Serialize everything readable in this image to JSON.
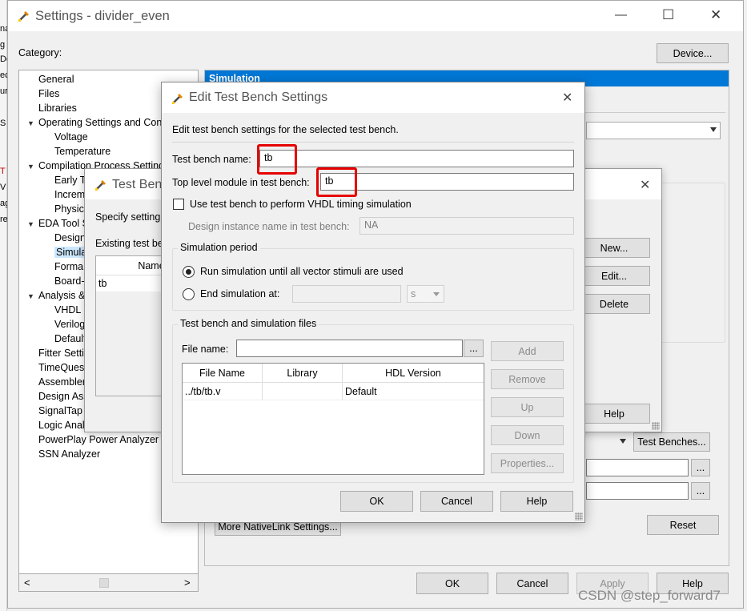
{
  "main": {
    "title": "Settings - divider_even",
    "category_label": "Category:",
    "device_button": "Device...",
    "left_edge": [
      "na",
      "g",
      "De",
      "ec",
      "ur",
      "S",
      "T",
      "V",
      "ag",
      "re"
    ],
    "tree": [
      {
        "label": "General",
        "level": 1
      },
      {
        "label": "Files",
        "level": 1
      },
      {
        "label": "Libraries",
        "level": 1
      },
      {
        "label": "Operating Settings and Con",
        "level": 0
      },
      {
        "label": "Voltage",
        "level": 2
      },
      {
        "label": "Temperature",
        "level": 2
      },
      {
        "label": "Compilation Process Setting",
        "level": 0
      },
      {
        "label": "Early T",
        "level": 2
      },
      {
        "label": "Increm",
        "level": 2
      },
      {
        "label": "Physica",
        "level": 2
      },
      {
        "label": "EDA Tool S",
        "level": 0
      },
      {
        "label": "Design",
        "level": 2
      },
      {
        "label": "Simula",
        "level": 2
      },
      {
        "label": "Forma",
        "level": 2
      },
      {
        "label": "Board-",
        "level": 2
      },
      {
        "label": "Analysis &",
        "level": 0
      },
      {
        "label": "VHDL I",
        "level": 2
      },
      {
        "label": "Verilog",
        "level": 2
      },
      {
        "label": "Default",
        "level": 2
      },
      {
        "label": "Fitter Setti",
        "level": 1
      },
      {
        "label": "TimeQues",
        "level": 1
      },
      {
        "label": "Assembler",
        "level": 1
      },
      {
        "label": "Design Ass",
        "level": 1
      },
      {
        "label": "SignalTap",
        "level": 1
      },
      {
        "label": "Logic Anal",
        "level": 1
      },
      {
        "label": "PowerPlay Power Analyzer",
        "level": 1
      },
      {
        "label": "SSN Analyzer",
        "level": 1
      }
    ],
    "panel_header": "Simulation",
    "more_nativelink_button": "More NativeLink Settings...",
    "reset_button": "Reset",
    "test_benches_button": "Test Benches...",
    "browse_label": "...",
    "ok": "OK",
    "cancel": "Cancel",
    "apply": "Apply",
    "help": "Help",
    "scroll_left": "<",
    "scroll_right": ">",
    "minimize": "—",
    "maximize": "☐",
    "close": "✕"
  },
  "test_benches_dialog": {
    "title": "Test Bench",
    "specify_text": "Specify setting",
    "existing_label": "Existing test be",
    "column_name": "Name",
    "row_name": "tb",
    "new_button": "New...",
    "edit_button": "Edit...",
    "delete_button": "Delete",
    "help_button": "Help",
    "close": "✕"
  },
  "edit_dialog": {
    "title": "Edit Test Bench Settings",
    "description": "Edit test bench settings for the selected test bench.",
    "tb_name_label": "Test bench name:",
    "tb_name_value": "tb",
    "top_module_label": "Top level module in test bench:",
    "top_module_value": "tb",
    "use_tb_checkbox_label": "Use test bench to perform VHDL timing simulation",
    "design_instance_label": "Design instance name in test bench:",
    "design_instance_value": "NA",
    "sim_period_title": "Simulation period",
    "radio_run_all": "Run simulation until all vector stimuli are used",
    "radio_end_at": "End simulation at:",
    "end_at_unit": "s",
    "files_group_title": "Test bench and simulation files",
    "file_name_label": "File name:",
    "browse_label": "...",
    "add_button": "Add",
    "remove_button": "Remove",
    "up_button": "Up",
    "down_button": "Down",
    "properties_button": "Properties...",
    "table_headers": [
      "File Name",
      "Library",
      "HDL Version"
    ],
    "table_rows": [
      [
        "../tb/tb.v",
        "",
        "Default"
      ]
    ],
    "ok": "OK",
    "cancel": "Cancel",
    "help": "Help",
    "close": "✕"
  },
  "watermark": "CSDN @step_forward7",
  "colors": {
    "accent_blue": "#0078d7",
    "highlight_red": "#e60000",
    "selection": "#cce8ff"
  }
}
